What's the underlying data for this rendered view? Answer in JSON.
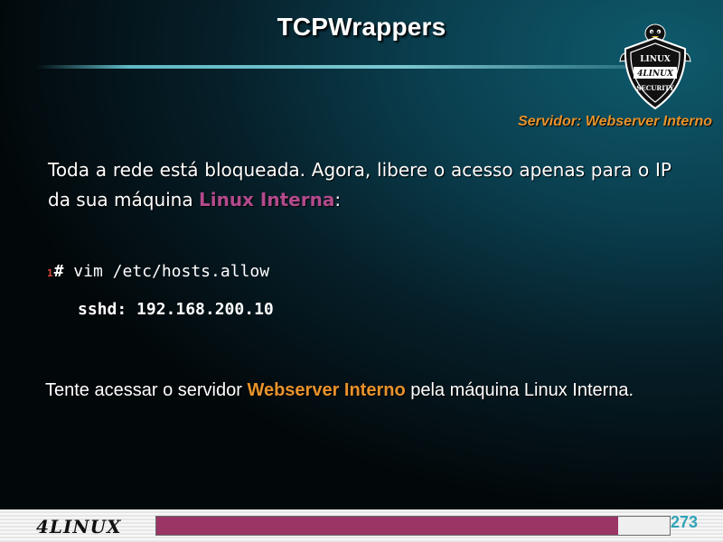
{
  "slide": {
    "title": "TCPWrappers",
    "subtitle": "Servidor: Webserver Interno",
    "intro_text": "Toda a rede está bloqueada. Agora, libere o acesso apenas para o IP da sua máquina ",
    "intro_highlight": "Linux Interna",
    "intro_suffix": ":",
    "command_line_number": "1",
    "command_prompt": "#",
    "command_text": " vim /etc/hosts.allow",
    "config_line": "sshd: 192.168.200.10",
    "task_prefix": "Tente acessar o servidor ",
    "task_highlight": "Webserver Interno",
    "task_suffix": " pela máquina Linux Interna."
  },
  "badge": {
    "top_text": "LINUX",
    "center_text": "4LINUX",
    "bottom_text": "SECURITY"
  },
  "footer": {
    "logo_text": "4LINUX",
    "progress_fraction": 0.9,
    "page_number": "273"
  },
  "colors": {
    "accent_orange": "#e8922b",
    "accent_purple": "#b34a8c",
    "progress_fill": "#9a3566",
    "page_number": "#2fa3b8",
    "line_number": "#d84a3a"
  }
}
